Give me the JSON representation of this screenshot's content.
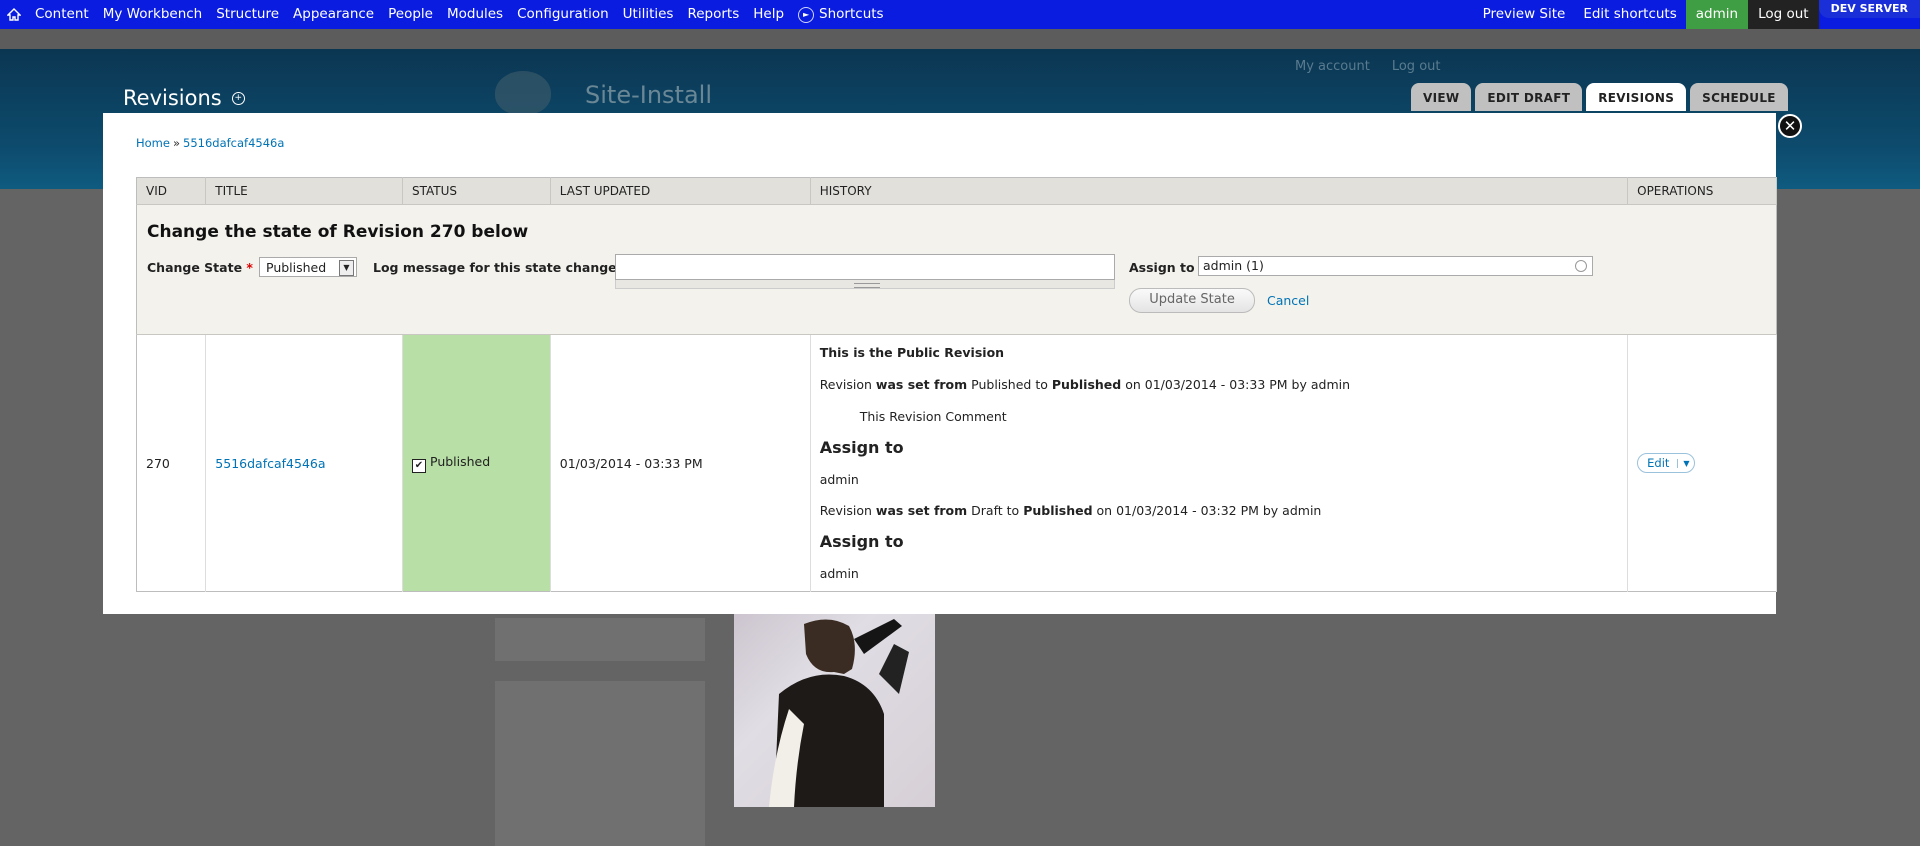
{
  "toolbar": {
    "items": [
      "Content",
      "My Workbench",
      "Structure",
      "Appearance",
      "People",
      "Modules",
      "Configuration",
      "Utilities",
      "Reports",
      "Help"
    ],
    "shortcuts_label": "Shortcuts",
    "preview_site": "Preview Site",
    "edit_shortcuts": "Edit shortcuts",
    "user": "admin",
    "logout": "Log out",
    "dev_badge": "DEV SERVER"
  },
  "page": {
    "title": "Revisions",
    "site_name": "Site-Install",
    "secondary_links": [
      "My account",
      "Log out"
    ],
    "tabs": [
      "VIEW",
      "EDIT DRAFT",
      "REVISIONS",
      "SCHEDULE"
    ]
  },
  "modal": {
    "breadcrumb": [
      "Home",
      "5516dafcaf4546a"
    ],
    "breadcrumb_sep": "»",
    "table": {
      "headers": [
        "VID",
        "TITLE",
        "STATUS",
        "LAST UPDATED",
        "HISTORY",
        "OPERATIONS"
      ]
    },
    "form": {
      "heading": "Change the state of Revision 270 below",
      "change_state_label": "Change State",
      "required_mark": "*",
      "change_state_value": "Published",
      "log_label": "Log message for this state change",
      "log_value": "",
      "assign_label": "Assign to",
      "assign_value": "admin (1)",
      "update_button": "Update State",
      "cancel": "Cancel"
    },
    "row": {
      "vid": "270",
      "title": "5516dafcaf4546a",
      "status": "Published",
      "last_updated": "01/03/2014 - 03:33 PM",
      "history": {
        "public_note": "This is the Public Revision",
        "entry1": {
          "prefix": "Revision",
          "bold1": "was set from",
          "from": "Published",
          "to_word": "to",
          "to": "Published",
          "suffix": "on 01/03/2014 - 03:33 PM by admin"
        },
        "comment": "This Revision Comment",
        "assign1_heading": "Assign to",
        "assign1_user": "admin",
        "entry2": {
          "prefix": "Revision",
          "bold1": "was set from",
          "from": "Draft",
          "to_word": "to",
          "to": "Published",
          "suffix": "on 01/03/2014 - 03:32 PM by admin"
        },
        "assign2_heading": "Assign to",
        "assign2_user": "admin"
      },
      "operation": "Edit"
    }
  }
}
